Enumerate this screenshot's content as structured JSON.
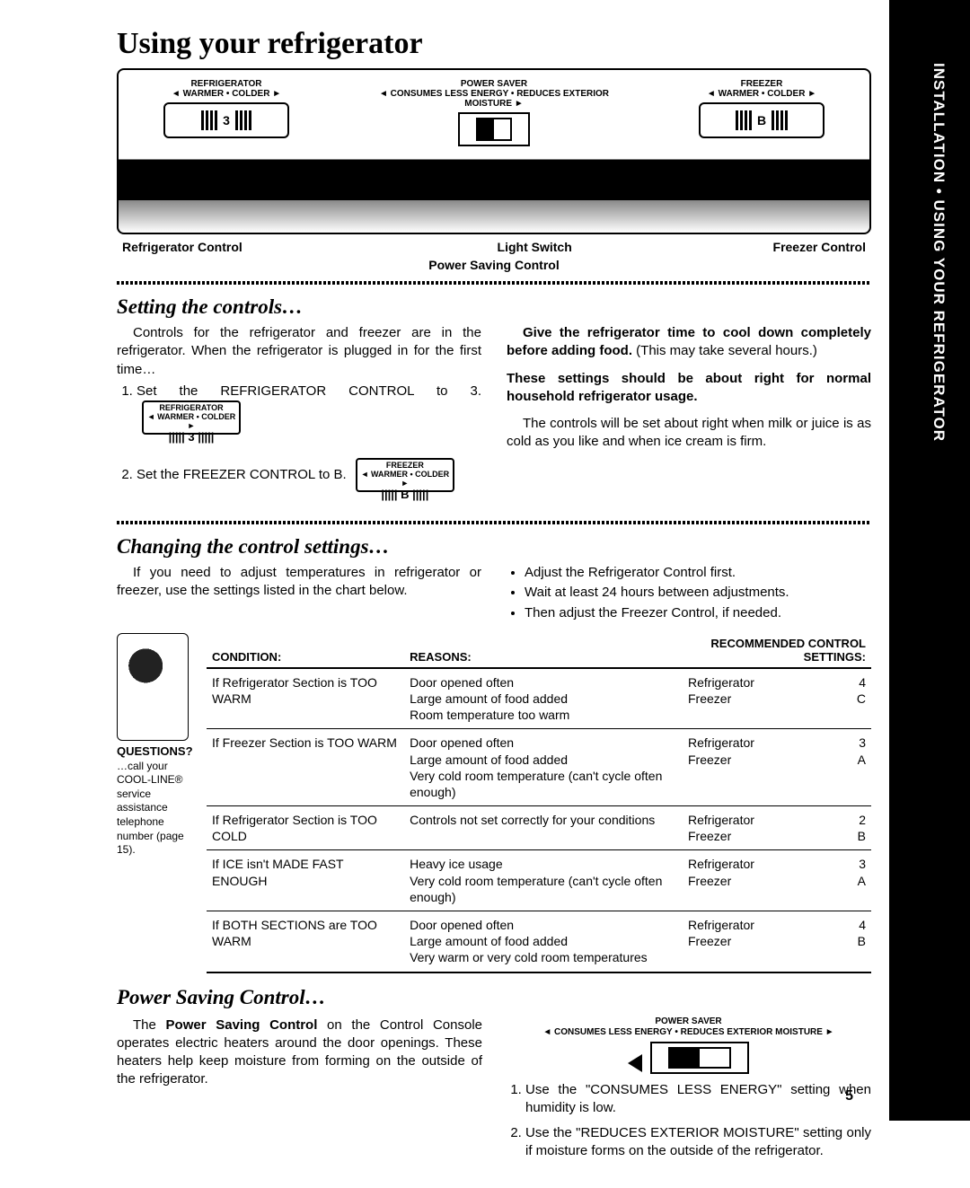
{
  "side_tab": "INSTALLATION • USING YOUR REFRIGERATOR",
  "title": "Using your refrigerator",
  "console": {
    "refrig_header": "REFRIGERATOR",
    "refrig_sub": "◄ WARMER • COLDER ►",
    "refrig_setting": "3",
    "power_header": "POWER SAVER",
    "power_sub": "◄ CONSUMES LESS ENERGY • REDUCES EXTERIOR MOISTURE ►",
    "freezer_header": "FREEZER",
    "freezer_sub": "◄ WARMER • COLDER ►",
    "freezer_setting": "B",
    "lbl_refrig": "Refrigerator Control",
    "lbl_light": "Light Switch",
    "lbl_freezer": "Freezer Control",
    "lbl_power": "Power Saving Control"
  },
  "sect1": {
    "heading": "Setting the controls…",
    "intro": "Controls for the refrigerator and freezer are in the refrigerator. When the refrigerator is plugged in for the first time…",
    "step1": "Set the REFRIGERATOR CONTROL to 3.",
    "step2": "Set the FREEZER CONTROL to B.",
    "mini_refrig_h": "REFRIGERATOR",
    "mini_refrig_s": "◄ WARMER • COLDER ►",
    "mini_freezer_h": "FREEZER",
    "mini_freezer_s": "◄ WARMER • COLDER ►",
    "right1_bold": "Give the refrigerator time to cool down completely before adding food.",
    "right1_rest": " (This may take several hours.)",
    "right2": "These settings should be about right for normal household refrigerator usage.",
    "right3": "The controls will be set about right when milk or juice is as cold as you like and when ice cream is firm."
  },
  "sect2": {
    "heading": "Changing the control settings…",
    "left": "If you need to adjust temperatures in refrigerator or freezer, use the settings listed in the chart below.",
    "b1": "Adjust the Refrigerator Control first.",
    "b2": "Wait at least 24 hours between adjustments.",
    "b3": "Then adjust the Freezer Control, if needed.",
    "side_q": "QUESTIONS?",
    "side_txt": "…call your COOL-LINE® service assistance telephone number (page 15).",
    "th1": "CONDITION:",
    "th2": "REASONS:",
    "th3": "RECOMMENDED CONTROL SETTINGS:",
    "rows": [
      {
        "cond": "If Refrigerator Section is TOO WARM",
        "reasons": "Door opened often\nLarge amount of food added\nRoom temperature too warm",
        "r_lbl": "Refrigerator",
        "r_val": "4",
        "f_lbl": "Freezer",
        "f_val": "C"
      },
      {
        "cond": "If Freezer Section is TOO WARM",
        "reasons": "Door opened often\nLarge amount of food added\nVery cold room temperature (can't cycle often enough)",
        "r_lbl": "Refrigerator",
        "r_val": "3",
        "f_lbl": "Freezer",
        "f_val": "A"
      },
      {
        "cond": "If Refrigerator Section is TOO COLD",
        "reasons": "Controls not set correctly for your conditions",
        "r_lbl": "Refrigerator",
        "r_val": "2",
        "f_lbl": "Freezer",
        "f_val": "B"
      },
      {
        "cond": "If ICE isn't MADE FAST ENOUGH",
        "reasons": "Heavy ice usage\nVery cold room temperature (can't cycle often enough)",
        "r_lbl": "Refrigerator",
        "r_val": "3",
        "f_lbl": "Freezer",
        "f_val": "A"
      },
      {
        "cond": "If BOTH SECTIONS are TOO WARM",
        "reasons": "Door opened often\nLarge amount of food added\nVery warm or very cold room temperatures",
        "r_lbl": "Refrigerator",
        "r_val": "4",
        "f_lbl": "Freezer",
        "f_val": "B"
      }
    ]
  },
  "sect3": {
    "heading": "Power Saving Control…",
    "left_pre": "The ",
    "left_bold": "Power Saving Control",
    "left_rest": " on the Control Console operates electric heaters around the door openings. These heaters help keep moisture from forming on the outside of the refrigerator.",
    "ps_header": "POWER SAVER",
    "ps_sub": "◄ CONSUMES LESS ENERGY • REDUCES EXTERIOR MOISTURE ►",
    "step1": "Use the \"CONSUMES LESS ENERGY\" setting when humidity is low.",
    "step2": "Use the \"REDUCES EXTERIOR MOISTURE\" setting only if moisture forms on the outside of the refrigerator."
  },
  "page_number": "5"
}
